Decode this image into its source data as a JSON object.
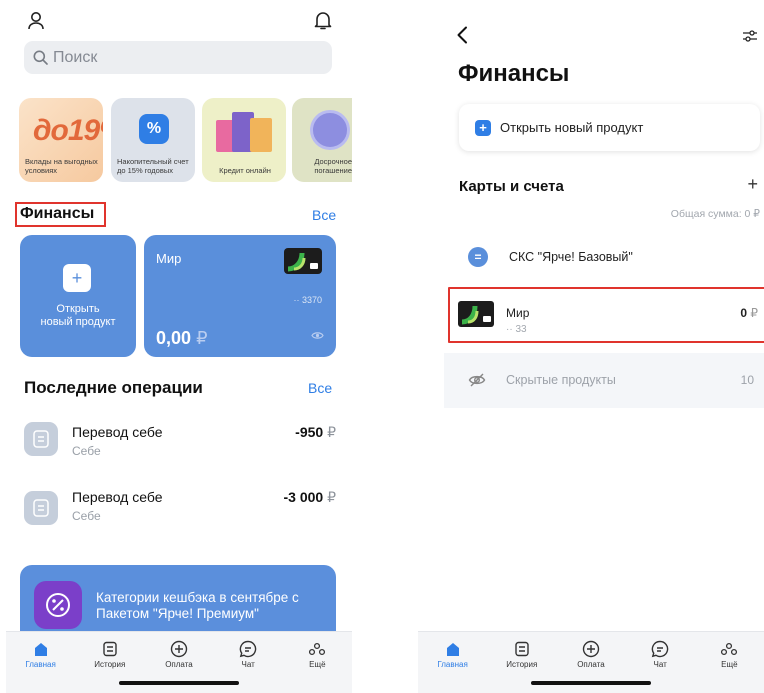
{
  "left": {
    "search_placeholder": "Поиск",
    "stories": [
      {
        "big": "до19%",
        "caption": "Вклады на выгодных условиях"
      },
      {
        "big": "%",
        "caption": "Накопительный счет до 15% годовых"
      },
      {
        "big": "",
        "caption": "Кредит онлайн"
      },
      {
        "big": "",
        "caption": "Досрочное погашение"
      }
    ],
    "finance_title": "Финансы",
    "finance_all": "Все",
    "open_card": {
      "plus": "+",
      "label_line1": "Открыть",
      "label_line2": "новый продукт"
    },
    "card": {
      "name": "Мир",
      "number": "·· 3370",
      "balance": "0,00",
      "currency": "₽"
    },
    "ops_title": "Последние операции",
    "ops_all": "Все",
    "operations": [
      {
        "title": "Перевод себе",
        "sub": "Себе",
        "amount": "-950",
        "currency": "₽"
      },
      {
        "title": "Перевод себе",
        "sub": "Себе",
        "amount": "-3 000",
        "currency": "₽"
      }
    ],
    "promo": "Категории кешбэка в сентябре с Пакетом \"Ярче! Премиум\""
  },
  "right": {
    "title": "Финансы",
    "new_product": "Открыть новый продукт",
    "cards_section": "Карты и счета",
    "add": "+",
    "total": "Общая сумма: 0 ₽",
    "account": {
      "name": "СКС \"Ярче! Базовый\"",
      "dot": "="
    },
    "card": {
      "name": "Мир",
      "number": "·· 33",
      "amount": "0",
      "currency": "₽"
    },
    "hidden": {
      "label": "Скрытые продукты",
      "count": "10"
    }
  },
  "tabs": [
    {
      "label": "Главная",
      "icon": "home-icon",
      "active": true
    },
    {
      "label": "История",
      "icon": "history-icon",
      "active": false
    },
    {
      "label": "Оплата",
      "icon": "payment-plus-icon",
      "active": false
    },
    {
      "label": "Чат",
      "icon": "chat-icon",
      "active": false
    },
    {
      "label": "Ещё",
      "icon": "more-dots-icon",
      "active": false
    }
  ],
  "colors": {
    "accent": "#2f7ee5",
    "card": "#5a8fdb",
    "highlight": "#e0342d"
  }
}
